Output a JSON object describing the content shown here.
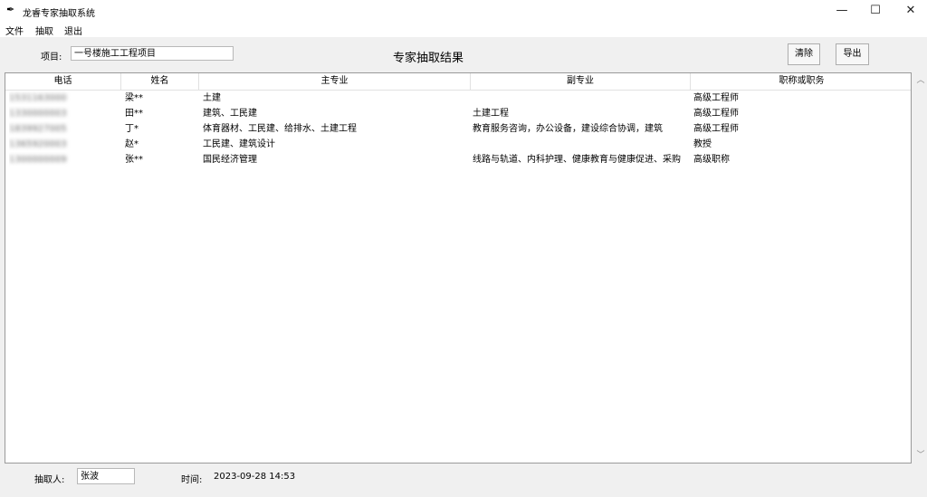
{
  "window": {
    "title": "龙睿专家抽取系统",
    "minimize": "—",
    "maximize": "☐",
    "close": "✕"
  },
  "menu": [
    "文件",
    "抽取",
    "退出"
  ],
  "toolbar": {
    "project_label": "项目:",
    "project_value": "一号楼施工工程项目",
    "page_title": "专家抽取结果",
    "clear_label": "清除",
    "export_label": "导出"
  },
  "table": {
    "columns": [
      "电话",
      "姓名",
      "主专业",
      "副专业",
      "职称或职务"
    ],
    "rows": [
      {
        "phone": "1531163000",
        "name": "梁**",
        "major": "土建",
        "minor": "",
        "title": "高级工程师"
      },
      {
        "phone": "1330000003",
        "name": "田**",
        "major": "建筑、工民建",
        "minor": "土建工程",
        "title": "高级工程师"
      },
      {
        "phone": "1839927005",
        "name": "丁*",
        "major": "体育器材、工民建、给排水、土建工程",
        "minor": "教育服务咨询，办公设备，建设综合协调，建筑",
        "title": "高级工程师"
      },
      {
        "phone": "1365920003",
        "name": "赵*",
        "major": "工民建、建筑设计",
        "minor": "",
        "title": "教授"
      },
      {
        "phone": "1300000009",
        "name": "张**",
        "major": "国民经济管理",
        "minor": "线路与轨道、内科护理、健康教育与健康促进、采购",
        "title": "高级职称"
      }
    ]
  },
  "status": {
    "drawer_label": "抽取人:",
    "drawer_value": "张波",
    "time_label": "时间:",
    "time_value": "2023-09-28 14:53"
  },
  "icons": {
    "app": "feather-icon",
    "scroll_up": "chevron-up-icon",
    "scroll_down": "chevron-down-icon"
  }
}
